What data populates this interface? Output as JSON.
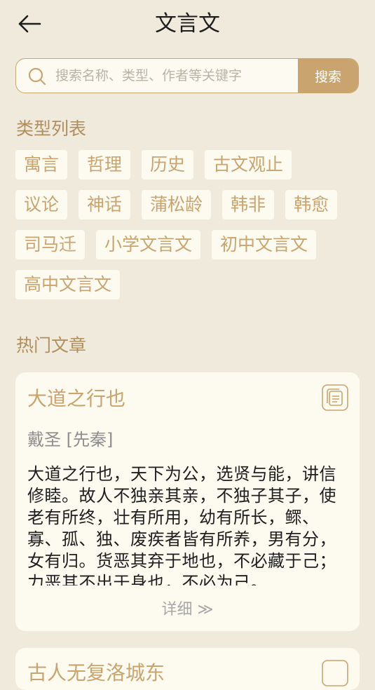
{
  "header": {
    "title": "文言文",
    "back_icon": "arrow-left-icon"
  },
  "search": {
    "placeholder": "搜索名称、类型、作者等关键字",
    "button_label": "搜索",
    "icon": "search-icon"
  },
  "categories": {
    "title": "类型列表",
    "rows": [
      [
        "寓言",
        "哲理",
        "历史",
        "古文观止"
      ],
      [
        "议论",
        "神话",
        "蒲松龄",
        "韩非",
        "韩愈"
      ],
      [
        "司马迁",
        "小学文言文",
        "初中文言文"
      ],
      [
        "高中文言文"
      ]
    ]
  },
  "hot": {
    "title": "热门文章",
    "articles": [
      {
        "title": "大道之行也",
        "author": "戴圣 [先秦]",
        "body": "大道之行也，天下为公，选贤与能，讲信修睦。故人不独亲其亲，不独子其子，使老有所终，壮有所用，幼有所长，鳏、寡、孤、独、废疾者皆有所养，男有分，女有归。货恶其弃于地也，不必藏于己；力恶其不出于身也，不必为己。",
        "more_label": "详细 ≫"
      },
      {
        "title": "古人无复洛城东"
      }
    ]
  },
  "colors": {
    "background": "#efeadb",
    "accent": "#c9a46e",
    "card": "#fdfaf0",
    "section_title": "#b08f5e"
  }
}
